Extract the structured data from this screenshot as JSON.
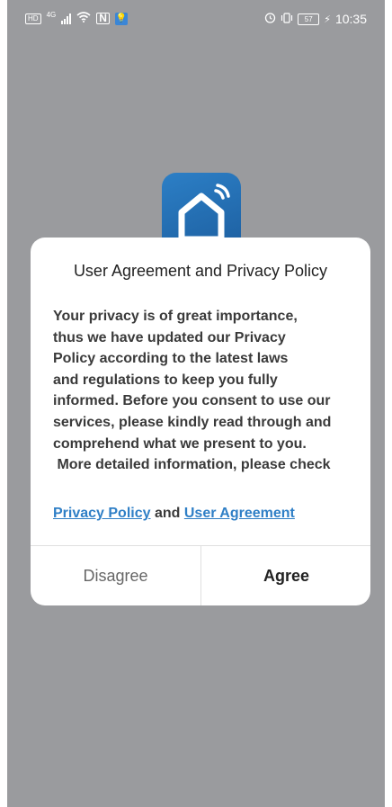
{
  "status_bar": {
    "hd_label": "HD",
    "network_label": "4G",
    "nfc_label": "N",
    "battery_level": "57",
    "time": "10:35"
  },
  "dialog": {
    "title": "User Agreement and Privacy Policy",
    "body_lines": [
      "Your privacy is of great importance,",
      "thus we have updated our Privacy",
      "Policy according to the latest laws",
      "and regulations to keep you fully",
      "informed. Before you consent to use our",
      "services, please kindly read through and",
      "comprehend what we present to you.",
      " More detailed information, please check"
    ],
    "privacy_link": "Privacy Policy",
    "and_text": " and ",
    "user_agreement_link": "User Agreement",
    "disagree_label": "Disagree",
    "agree_label": "Agree"
  },
  "colors": {
    "overlay": "#9a9b9e",
    "link": "#2f7fc6",
    "logo": "#2c7fc6"
  }
}
